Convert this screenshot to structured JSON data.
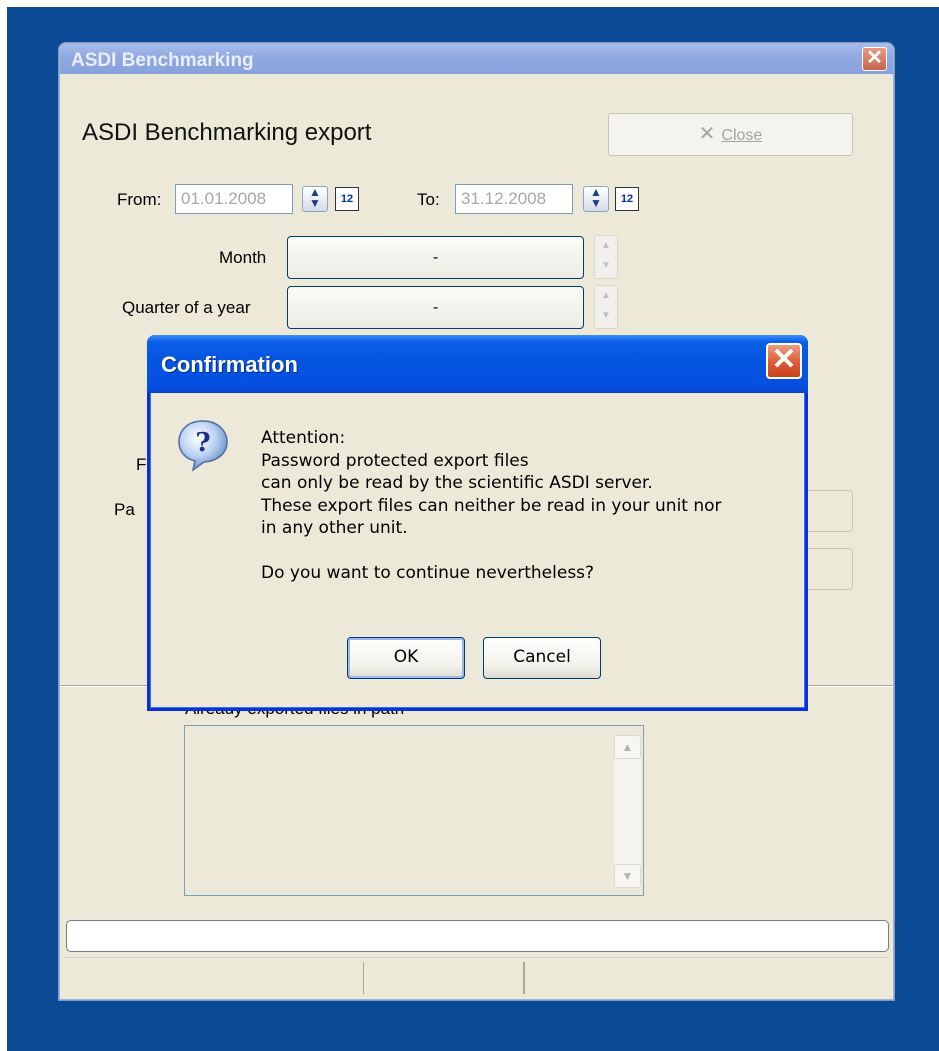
{
  "main_window": {
    "title": "ASDI Benchmarking",
    "close_glyph": "✕",
    "heading": "ASDI Benchmarking export",
    "close_button": {
      "label": "Close",
      "icon": "close-x-icon",
      "enabled": false
    },
    "from_label": "From:",
    "from_value": "01.01.2008",
    "to_label": "To:",
    "to_value": "31.12.2008",
    "month_label": "Month",
    "month_value": "-",
    "quarter_label": "Quarter of a year",
    "quarter_value": "-",
    "partial_label_1": "F",
    "partial_label_2": "Pa",
    "files_group_label": "Already exported files in path",
    "progress": 0
  },
  "dialog": {
    "title": "Confirmation",
    "close_glyph": "✕",
    "icon": "question-icon",
    "message_lines": [
      "Attention:",
      "Password protected export files",
      "can only be read by the scientific ASDI server.",
      "These export files can neither be read in your unit nor",
      "in any other unit.",
      "",
      "Do you want to continue nevertheless?"
    ],
    "ok_label": "OK",
    "cancel_label": "Cancel"
  },
  "colors": {
    "desktop": "#0b4a94",
    "window_face": "#ece9d8",
    "dialog_title": "#0453e0",
    "close_red": "#dd5530"
  }
}
